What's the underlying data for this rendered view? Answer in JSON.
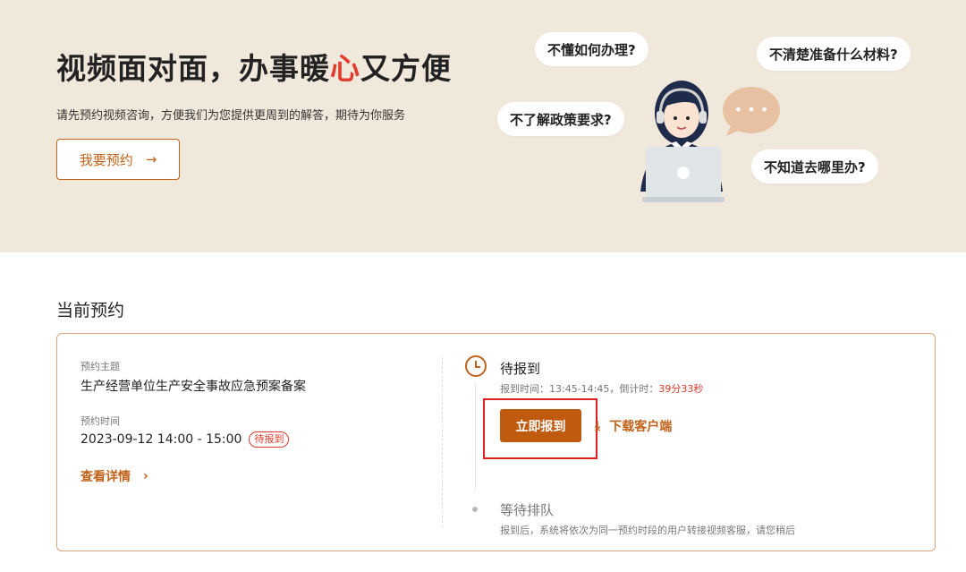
{
  "hero": {
    "title_pre": "视频面对面，办事暖",
    "title_heart": "心",
    "title_post": "又方便",
    "subtitle": "请先预约视频咨询，方便我们为您提供更周到的解答，期待为你服务",
    "button_label": "我要预约",
    "button_arrow": "→",
    "bubbles": [
      "不懂如何办理?",
      "不清楚准备什么材料?",
      "不了解政策要求?",
      "不知道去哪里办?"
    ],
    "chat_dots": "• • •"
  },
  "section": {
    "title": "当前预约"
  },
  "appointment": {
    "topic_label": "预约主题",
    "topic_value": "生产经营单位生产安全事故应急预案备案",
    "time_label": "预约时间",
    "time_value": "2023-09-12 14:00 - 15:00",
    "status_badge": "待报到",
    "detail_link": "查看详情",
    "detail_arrow": "›"
  },
  "timeline": {
    "step1_title": "待报到",
    "step1_desc": "报到时间：13:45-14:45，倒计时：",
    "countdown": "39分33秒",
    "checkin_button": "立即报到",
    "download_label": "下载客户端",
    "download_icon": "download-icon",
    "step2_title": "等待排队",
    "step2_desc": "报到后，系统将依次为同一预约时段的用户转接视频客服，请您稍后"
  },
  "colors": {
    "accent": "#bf5a0f",
    "hero_bg": "#f1e8dc",
    "alert": "#e0392b"
  }
}
